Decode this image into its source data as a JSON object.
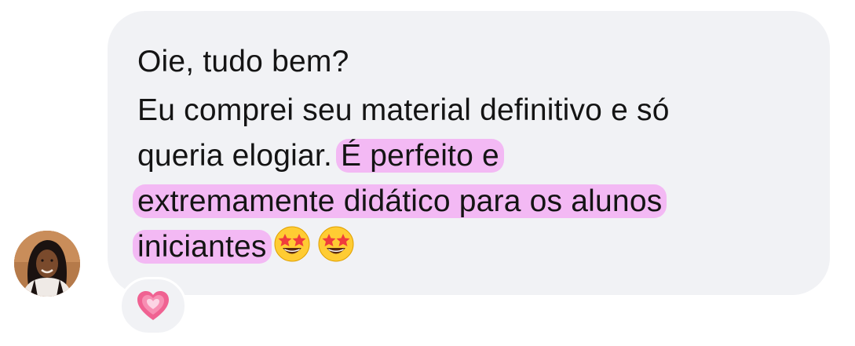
{
  "message": {
    "line1": "Oie, tudo bem?",
    "line2": "Eu comprei seu material definitivo e só",
    "line3_plain": "queria elogiar. ",
    "line3_highlight": "É perfeito e",
    "line4_highlight": "extremamente didático para os alunos",
    "line5_highlight": "iniciantes",
    "emojis": [
      "star-struck-icon",
      "star-struck-icon"
    ]
  },
  "reaction": {
    "emoji": "growing-heart-icon"
  },
  "colors": {
    "bubble": "#f1f2f5",
    "highlight": "#f3b9f4",
    "text": "#141414"
  }
}
